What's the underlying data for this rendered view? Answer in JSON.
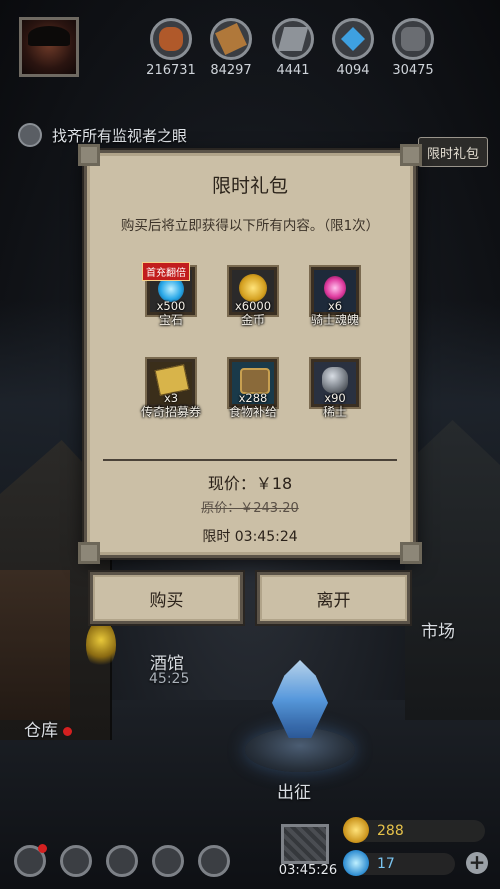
{
  "resources": [
    {
      "name": "wood-icon",
      "value": "216731",
      "color": "#b0592a"
    },
    {
      "name": "cloth-icon",
      "value": "84297",
      "color": "#b0783a"
    },
    {
      "name": "iron-icon",
      "value": "4441",
      "color": "#8e9399"
    },
    {
      "name": "crystal-icon",
      "value": "4094",
      "color": "#3ea0e0"
    },
    {
      "name": "ore-icon",
      "value": "30475",
      "color": "#6a6d72"
    }
  ],
  "quest": {
    "text": "找齐所有监视者之眼"
  },
  "tag_button": "限时礼包",
  "modal": {
    "title": "限时礼包",
    "subtitle": "购买后将立即获得以下所有内容。（限1次）",
    "items": [
      {
        "icon": "gem-icon",
        "qty": "x500",
        "name": "宝石",
        "badge": "首充翻倍",
        "color": "#2aa8e8"
      },
      {
        "icon": "gold-coin-icon",
        "qty": "x6000",
        "name": "金币",
        "color": "#d4a020"
      },
      {
        "icon": "knight-soul-icon",
        "qty": "x6",
        "name": "骑士魂魄",
        "color": "#e03ca0"
      },
      {
        "icon": "recruit-scroll-icon",
        "qty": "x3",
        "name": "传奇招募券",
        "color": "#d8b44a"
      },
      {
        "icon": "food-supply-icon",
        "qty": "x288",
        "name": "食物补给",
        "color": "#3a8fb0"
      },
      {
        "icon": "rare-soldier-icon",
        "qty": "x90",
        "name": "稀土",
        "color": "#8a9098"
      }
    ],
    "price_now": "现价：￥18",
    "price_old": "原价：￥243.20",
    "timer": "限时 03:45:24"
  },
  "buttons": {
    "buy": "购买",
    "leave": "离开"
  },
  "map": {
    "market": "市场",
    "tavern": "酒馆",
    "tavern_timer": "45:25",
    "warehouse": "仓库",
    "expedition": "出征"
  },
  "bottom": {
    "gift_timer": "03:45:26",
    "gold": "288",
    "gems": "17"
  }
}
